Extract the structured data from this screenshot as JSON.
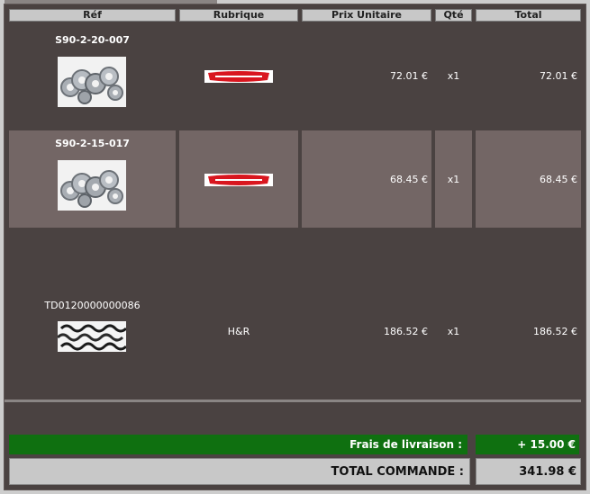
{
  "headers": {
    "ref": "Réf",
    "rubrique": "Rubrique",
    "prix": "Prix Unitaire",
    "qte": "Qté",
    "total": "Total"
  },
  "rows": [
    {
      "ref": "S90-2-20-007",
      "rubrique_logo": "eibach-logo",
      "prix": "72.01 €",
      "qte": "x1",
      "total": "72.01 €",
      "image": "wheel-spacers-image"
    },
    {
      "ref": "S90-2-15-017",
      "rubrique_logo": "eibach-logo",
      "prix": "68.45 €",
      "qte": "x1",
      "total": "68.45 €",
      "image": "wheel-spacers-image"
    },
    {
      "ref": "TD0120000000086",
      "rubrique": "H&R",
      "prix": "186.52 €",
      "qte": "x1",
      "total": "186.52 €",
      "image": "coil-springs-image"
    }
  ],
  "shipping": {
    "label": "Frais de livraison :",
    "value": "+ 15.00 €"
  },
  "total": {
    "label": "TOTAL COMMANDE :",
    "value": "341.98 €"
  },
  "colors": {
    "background": "#4a4241",
    "shaded_row": "#736665",
    "shipping_bar": "#0f7010",
    "header": "#c8c8c8",
    "eibach_red": "#d9161f"
  }
}
